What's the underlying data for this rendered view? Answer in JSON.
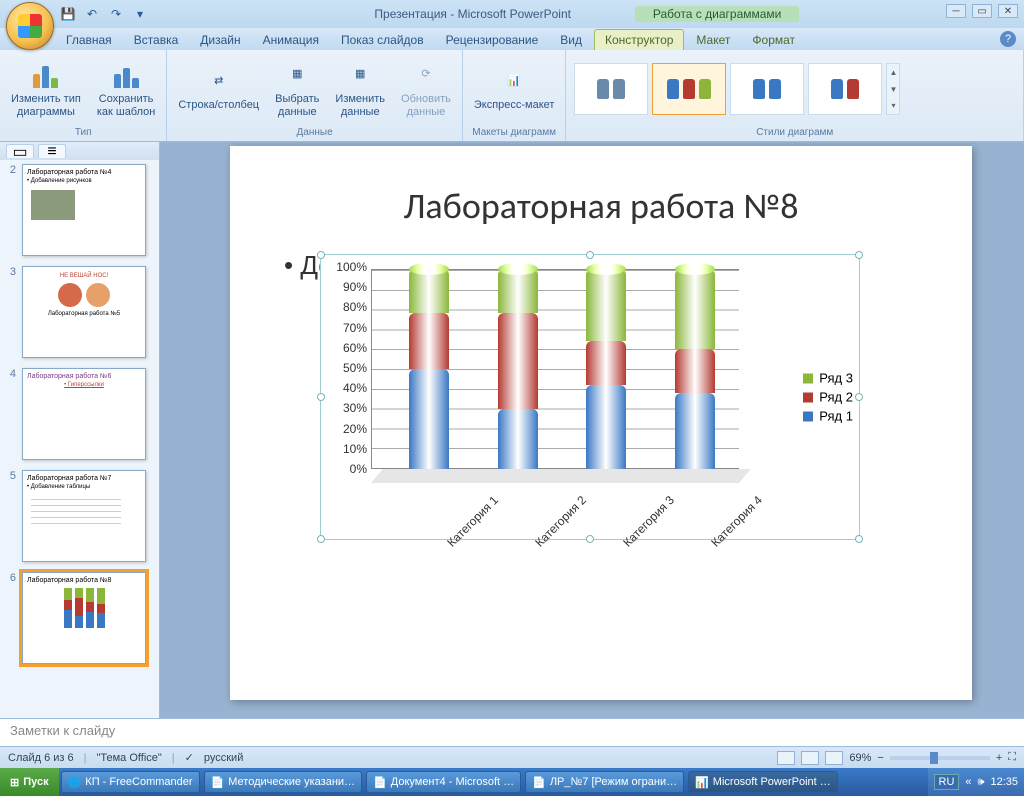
{
  "title": {
    "app": "Презентация - Microsoft PowerPoint",
    "context": "Работа с диаграммами"
  },
  "tabs": {
    "home": "Главная",
    "insert": "Вставка",
    "design": "Дизайн",
    "anim": "Анимация",
    "show": "Показ слайдов",
    "review": "Рецензирование",
    "view": "Вид",
    "designer": "Конструктор",
    "layout": "Макет",
    "format": "Формат"
  },
  "ribbon": {
    "type_group": "Тип",
    "change_type": "Изменить тип\nдиаграммы",
    "save_template": "Сохранить\nкак шаблон",
    "data_group": "Данные",
    "switch_rc": "Строка/столбец",
    "select_data": "Выбрать\nданные",
    "edit_data": "Изменить\nданные",
    "refresh_data": "Обновить\nданные",
    "layouts_group": "Макеты диаграмм",
    "express_layout": "Экспресс-макет",
    "styles_group": "Стили диаграмм"
  },
  "slide": {
    "title": "Лабораторная работа №8",
    "bullet": "Добавление диаграмм"
  },
  "chart_data": {
    "type": "bar",
    "stacked": true,
    "percent": true,
    "categories": [
      "Категория 1",
      "Категория 2",
      "Категория 3",
      "Категория 4"
    ],
    "series": [
      {
        "name": "Ряд 1",
        "color": "#3a78c4",
        "values": [
          50,
          30,
          42,
          38
        ]
      },
      {
        "name": "Ряд 2",
        "color": "#b43a32",
        "values": [
          28,
          48,
          22,
          22
        ]
      },
      {
        "name": "Ряд 3",
        "color": "#8bb63a",
        "values": [
          22,
          22,
          36,
          40
        ]
      }
    ],
    "ylabel": "",
    "ylim": [
      0,
      100
    ],
    "yticks": [
      "0%",
      "10%",
      "20%",
      "30%",
      "40%",
      "50%",
      "60%",
      "70%",
      "80%",
      "90%",
      "100%"
    ]
  },
  "thumbs": {
    "t2": "Лабораторная работа №4",
    "t2b": "• Добавление рисунков",
    "t3a": "НЕ ВЕШАЙ НОС!",
    "t3b": "Лабораторная работа №5",
    "t4": "Лабораторная работа №6",
    "t4b": "• Гиперссылки",
    "t5": "Лабораторная работа №7",
    "t5b": "• Добавление таблицы",
    "t6": "Лабораторная работа №8"
  },
  "notes_placeholder": "Заметки к слайду",
  "status": {
    "slide": "Слайд 6 из 6",
    "theme": "\"Тема Office\"",
    "lang": "русский",
    "zoom": "69%"
  },
  "taskbar": {
    "start": "Пуск",
    "t1": "КП - FreeCommander",
    "t2": "Методические указани…",
    "t3": "Документ4 - Microsoft …",
    "t4": "ЛР_№7 [Режим ограни…",
    "t5": "Microsoft PowerPoint …",
    "lang": "RU",
    "time": "12:35"
  }
}
